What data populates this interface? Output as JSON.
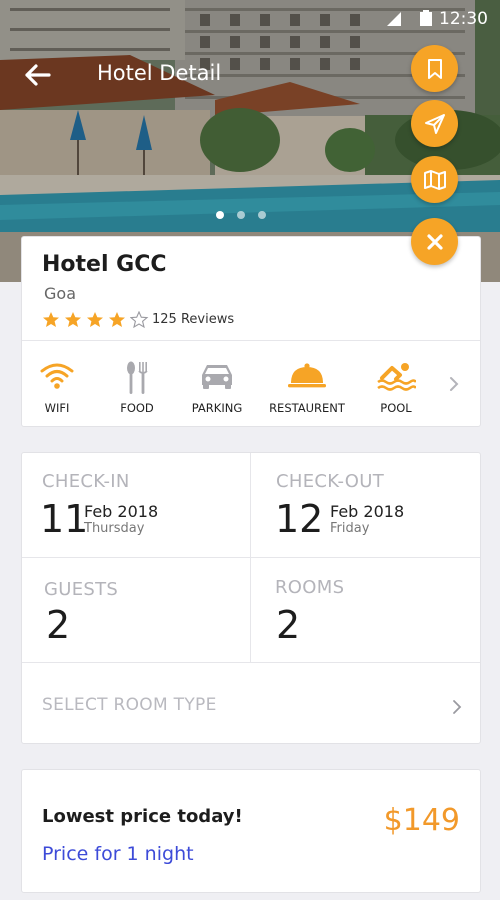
{
  "status_bar": {
    "time": "12:30"
  },
  "header": {
    "title": "Hotel Detail"
  },
  "carousel": {
    "slide_count": 3,
    "active_index": 0
  },
  "hotel": {
    "name": "Hotel GCC",
    "city": "Goa",
    "rating": 4,
    "rating_max": 5,
    "reviews": "125 Reviews"
  },
  "amenities": [
    {
      "label": "WIFI",
      "icon": "wifi-icon",
      "color": "#f6a426"
    },
    {
      "label": "FOOD",
      "icon": "fork-spoon-icon",
      "color": "#a9a9ae"
    },
    {
      "label": "PARKING",
      "icon": "car-icon",
      "color": "#a9a9ae"
    },
    {
      "label": "RESTAURENT",
      "icon": "cloche-icon",
      "color": "#f6a426"
    },
    {
      "label": "POOL",
      "icon": "swimmer-icon",
      "color": "#f6a426"
    }
  ],
  "booking": {
    "checkin": {
      "label": "CHECK-IN",
      "day": "11",
      "month_year": "Feb 2018",
      "weekday": "Thursday"
    },
    "checkout": {
      "label": "CHECK-OUT",
      "day": "12",
      "month_year": "Feb 2018",
      "weekday": "Friday"
    },
    "guests": {
      "label": "GUESTS",
      "value": "2"
    },
    "rooms": {
      "label": "ROOMS",
      "value": "2"
    },
    "room_type": {
      "label": "SELECT ROOM TYPE"
    }
  },
  "price": {
    "title": "Lowest price today!",
    "subtitle": "Price for 1 night",
    "value": "$149"
  },
  "colors": {
    "accent": "#f6a426",
    "price": "#f2992a",
    "link": "#3d4bd8"
  }
}
